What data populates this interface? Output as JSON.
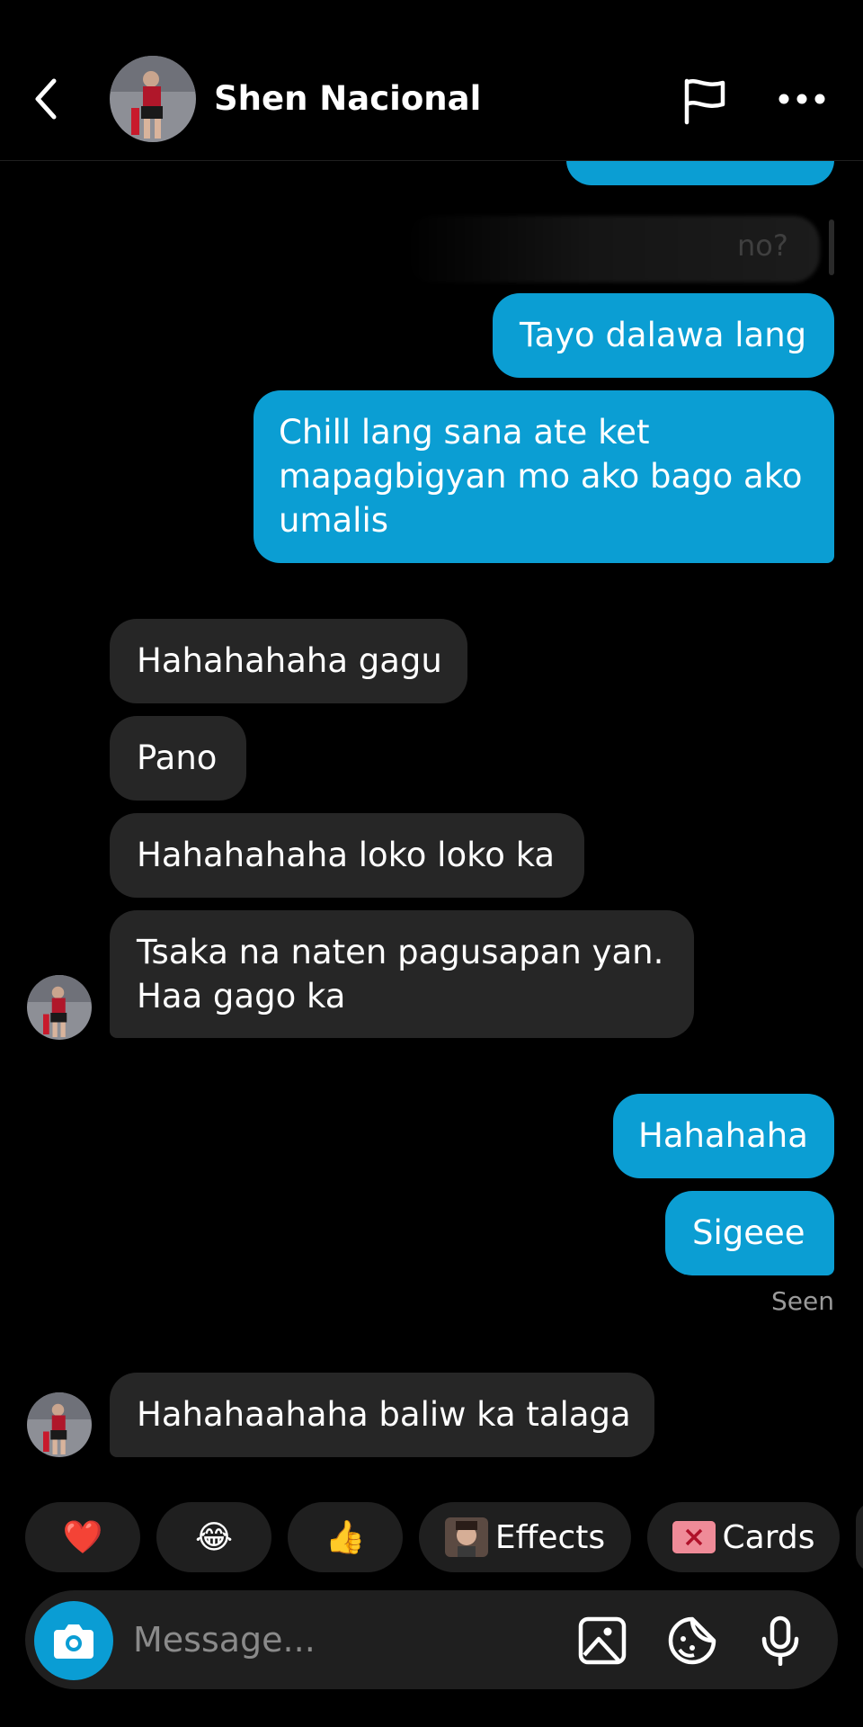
{
  "header": {
    "contact_name": "Shen Nacional"
  },
  "messages": {
    "out_partial_text": "",
    "faded_text": "no?",
    "out_1": "Tayo dalawa lang",
    "out_2_lines": [
      "Chill lang sana ate ket",
      "mapagbigyan mo ako bago ako",
      "umalis"
    ],
    "in_1": "Hahahahaha gagu",
    "in_2": "Pano",
    "in_3": "Hahahahaha loko loko ka",
    "in_4_lines": [
      "Tsaka na naten pagusapan yan.",
      "Haa gago ka"
    ],
    "out_3": "Hahahaha",
    "out_4": "Sigeee",
    "seen": "Seen",
    "in_5": "Hahahaahaha baliw ka talaga"
  },
  "reactions": {
    "heart": "❤️",
    "laugh": "😂",
    "thumbs": "👍",
    "effects_label": "Effects",
    "cards_label": "Cards"
  },
  "composer": {
    "placeholder": "Message..."
  },
  "colors": {
    "outgoing_bubble": "#0b9ed3",
    "incoming_bubble": "#262626",
    "background": "#000000",
    "accent": "#0a9dd4"
  },
  "icons": [
    "back-chevron-icon",
    "flag-icon",
    "more-icon",
    "camera-icon",
    "gallery-icon",
    "sticker-icon",
    "microphone-icon"
  ]
}
